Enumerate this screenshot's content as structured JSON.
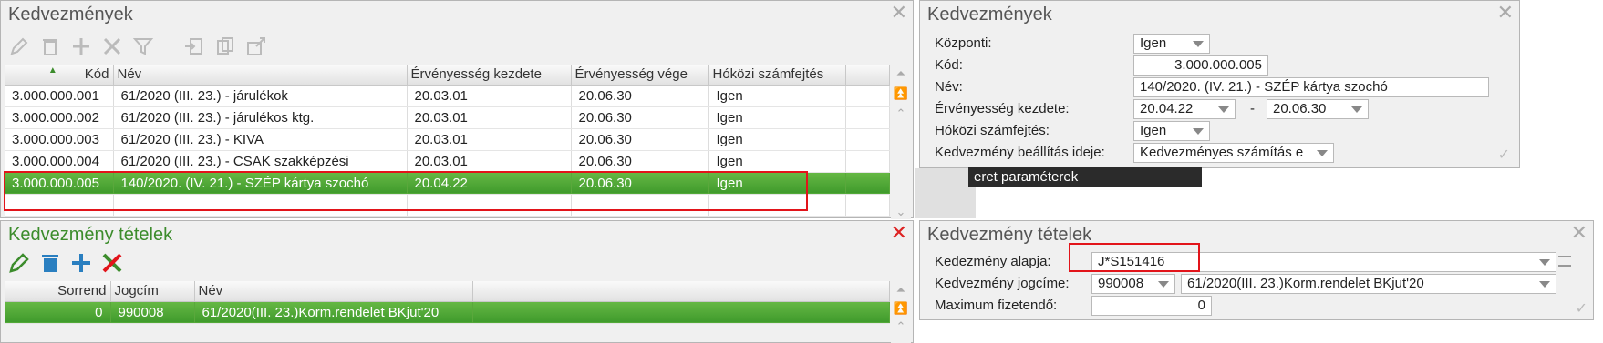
{
  "left_top": {
    "title": "Kedvezmények",
    "columns": [
      "Kód",
      "Név",
      "Érvényesség kezdete",
      "Érvényesség vége",
      "Hóközi számfejtés"
    ],
    "rows": [
      [
        "3.000.000.001",
        "61/2020 (III. 23.) - járulékok",
        "20.03.01",
        "20.06.30",
        "Igen"
      ],
      [
        "3.000.000.002",
        "61/2020 (III. 23.) - járulékos ktg.",
        "20.03.01",
        "20.06.30",
        "Igen"
      ],
      [
        "3.000.000.003",
        "61/2020 (III. 23.) - KIVA",
        "20.03.01",
        "20.06.30",
        "Igen"
      ],
      [
        "3.000.000.004",
        "61/2020 (III. 23.) - CSAK szakképzési",
        "20.03.01",
        "20.06.30",
        "Igen"
      ],
      [
        "3.000.000.005",
        "140/2020. (IV. 21.) - SZÉP kártya szochó",
        "20.04.22",
        "20.06.30",
        "Igen"
      ]
    ]
  },
  "right_top": {
    "title": "Kedvezmények",
    "labels": {
      "kozponti": "Központi:",
      "kod": "Kód:",
      "nev": "Név:",
      "ervenyesseg": "Érvényesség kezdete:",
      "hokozi": "Hóközi számfejtés:",
      "beallitas": "Kedvezmény beállítás ideje:"
    },
    "values": {
      "kozponti": "Igen",
      "kod": "3.000.000.005",
      "nev": "140/2020. (IV. 21.) - SZÉP kártya szochó",
      "kezdete": "20.04.22",
      "dash": "-",
      "vege": "20.06.30",
      "hokozi": "Igen",
      "beallitas": "Kedvezményes számítás e"
    }
  },
  "tooltip": "eret paraméterek",
  "left_bottom": {
    "title": "Kedvezmény tételek",
    "columns": [
      "Sorrend",
      "Jogcím",
      "Név"
    ],
    "rows": [
      [
        "0",
        "990008",
        "61/2020(III. 23.)Korm.rendelet BKjut'20"
      ]
    ]
  },
  "right_bottom": {
    "title": "Kedvezmény tételek",
    "labels": {
      "alapja": "Kedezmény alapja:",
      "jogcime": "Kedvezmény jogcíme:",
      "maximum": "Maximum fizetendő:"
    },
    "values": {
      "alapja": "J*S151416",
      "jogcim_code": "990008",
      "jogcim_name": "61/2020(III. 23.)Korm.rendelet BKjut'20",
      "maximum": "0"
    }
  },
  "colors": {
    "selected_row": "#4ea834",
    "highlight": "#e2141a",
    "green_icon": "#3c8c2c",
    "blue_icon": "#2a7fc0"
  }
}
